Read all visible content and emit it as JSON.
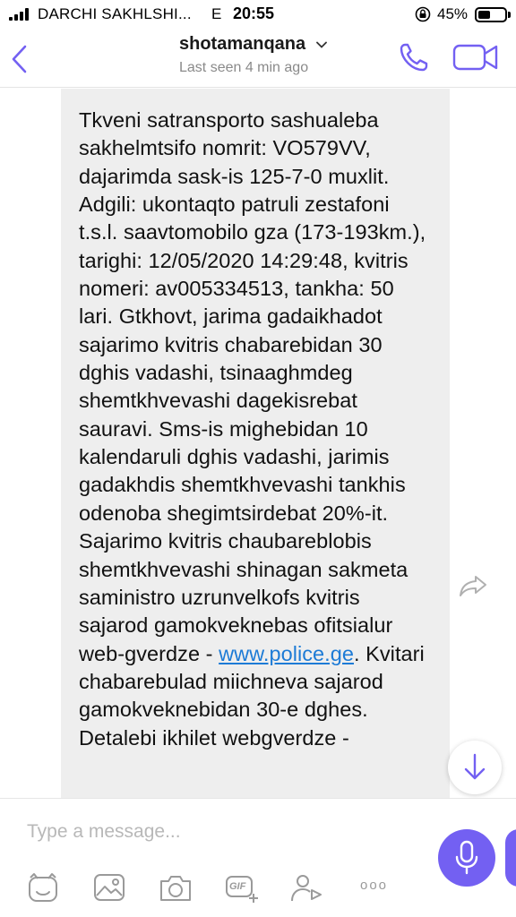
{
  "status": {
    "carrier": "DARCHI SAKHLSHI...",
    "network": "E",
    "time": "20:55",
    "battery": "45%",
    "battery_level": 0.45
  },
  "header": {
    "title": "shotamanqana",
    "last_seen": "Last seen 4 min ago"
  },
  "message": {
    "text_before_link": "Tkveni satransporto sashualeba sakhelmtsifo nomrit: VO579VV, dajarimda sask-is 125-7-0 muxlit. Adgili: ukontaqto patruli zestafoni t.s.l. saavtomobilo gza (173-193km.), tarighi: 12/05/2020 14:29:48, kvitris nomeri: av005334513, tankha: 50 lari. Gtkhovt, jarima gadaikhadot sajarimo kvitris chabarebidan 30 dghis vadashi, tsinaaghmdeg shemtkhvevashi dagekisrebat sauravi. Sms-is mighebidan 10 kalendaruli dghis vadashi, jarimis gadakhdis shemtkhvevashi tankhis odenoba shegimtsirdebat 20%-it. Sajarimo kvitris chaubareblobis shemtkhvevashi shinagan sakmeta saministro uzrunvelkofs kvitris sajarod gamokveknebas ofitsialur web-gverdze - ",
    "link": "www.police.ge",
    "text_after_link": ". Kvitari chabarebulad miichneva sajarod gamokveknebidan 30-e dghes. Detalebi ikhilet webgverdze -"
  },
  "composer": {
    "placeholder": "Type a message..."
  },
  "toolbar": {
    "items": [
      "sticker-icon",
      "gallery-icon",
      "camera-icon",
      "gif-icon",
      "share-contact-icon",
      "more-icon"
    ],
    "gif_label": "GIF",
    "more_label": "ooo"
  },
  "colors": {
    "accent": "#7360f2",
    "link": "#1d7bd6",
    "bubble": "#eeeeee"
  }
}
